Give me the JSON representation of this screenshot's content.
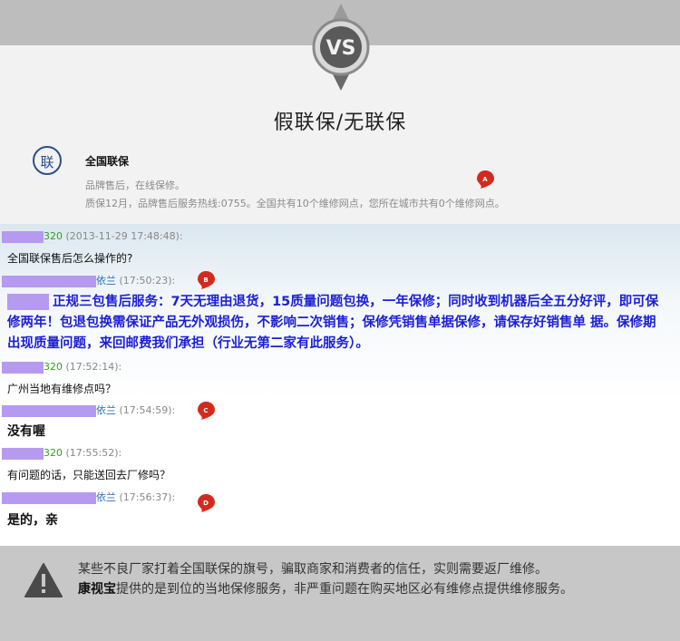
{
  "header": {
    "badge_text": "VS",
    "title": "假联保/无联保"
  },
  "info": {
    "icon_char": "联",
    "title": "全国联保",
    "subtitle": "品牌售后，在线保修。",
    "detail": "质保12月，品牌售后服务热线:0755。全国共有10个维修网点，您所在城市共有0个维修网点。"
  },
  "markers": [
    "A",
    "B",
    "C",
    "D"
  ],
  "chat": {
    "messages": [
      {
        "user": "320",
        "time": "(2013-11-29 17:48:48):",
        "text": "全国联保售后怎么操作的?"
      },
      {
        "user": "依兰",
        "time": "(17:50:23):",
        "text": "正规三包售后服务：7天无理由退货，15质量问题包换，一年保修；同时收到机器后全五分好评，即可保修两年！包退包换需保证产品无外观损伤，不影响二次销售；保修凭销售单据保修，请保存好销售单 据。保修期出现质量问题，来回邮费我们承担（行业无第二家有此服务）。"
      },
      {
        "user": "320",
        "time": "(17:52:14):",
        "text": "广州当地有维修点吗？"
      },
      {
        "user": "依兰",
        "time": "(17:54:59):",
        "text": "没有喔"
      },
      {
        "user": "320",
        "time": "(17:55:52):",
        "text": "有问题的话，只能送回去厂修吗？"
      },
      {
        "user": "依兰",
        "time": "(17:56:37):",
        "text": "是的，亲"
      }
    ]
  },
  "footer": {
    "line1": "某些不良厂家打着全国联保的旗号，骗取商家和消费者的信任，实则需要返厂维修。",
    "brand": "康视宝",
    "line2_rest": "提供的是到位的当地保修服务，非严重问题在购买地区必有维修点提供维修服务。"
  },
  "colors": {
    "pin_red": "#d42a1e",
    "highlight_blue": "#1b1fd6",
    "user_green": "#3a9a2a",
    "user_blue": "#2b6fb8",
    "redaction": "#b59af0"
  }
}
